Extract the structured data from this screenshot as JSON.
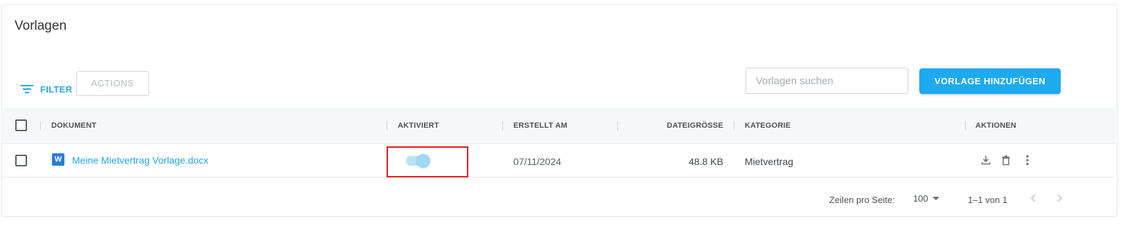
{
  "title": "Vorlagen",
  "toolbar": {
    "filter_label": "FILTER",
    "actions_label": "ACTIONS",
    "search_placeholder": "Vorlagen suchen",
    "add_label": "VORLAGE HINZUFÜGEN"
  },
  "table": {
    "columns": [
      "DOKUMENT",
      "AKTIVIERT",
      "ERSTELLT AM",
      "DATEIGRÖSSE",
      "KATEGORIE",
      "AKTIONEN"
    ],
    "rows": [
      {
        "document": "Meine Mietvertrag Vorlage.docx",
        "file_icon_letter": "W",
        "activated": true,
        "created": "07/11/2024",
        "size": "48.8 KB",
        "category": "Mietvertrag",
        "action_icons": [
          "download-icon",
          "trash-icon",
          "more-vertical-icon"
        ]
      }
    ]
  },
  "pagination": {
    "rows_per_page_label": "Zeilen pro Seite:",
    "rows_per_page": "100",
    "range": "1–1 von 1"
  },
  "colors": {
    "accent": "#1eaaef",
    "link": "#1ea5e8",
    "highlight": "#e01b1b",
    "toggle_on": "#9ed8f3"
  }
}
